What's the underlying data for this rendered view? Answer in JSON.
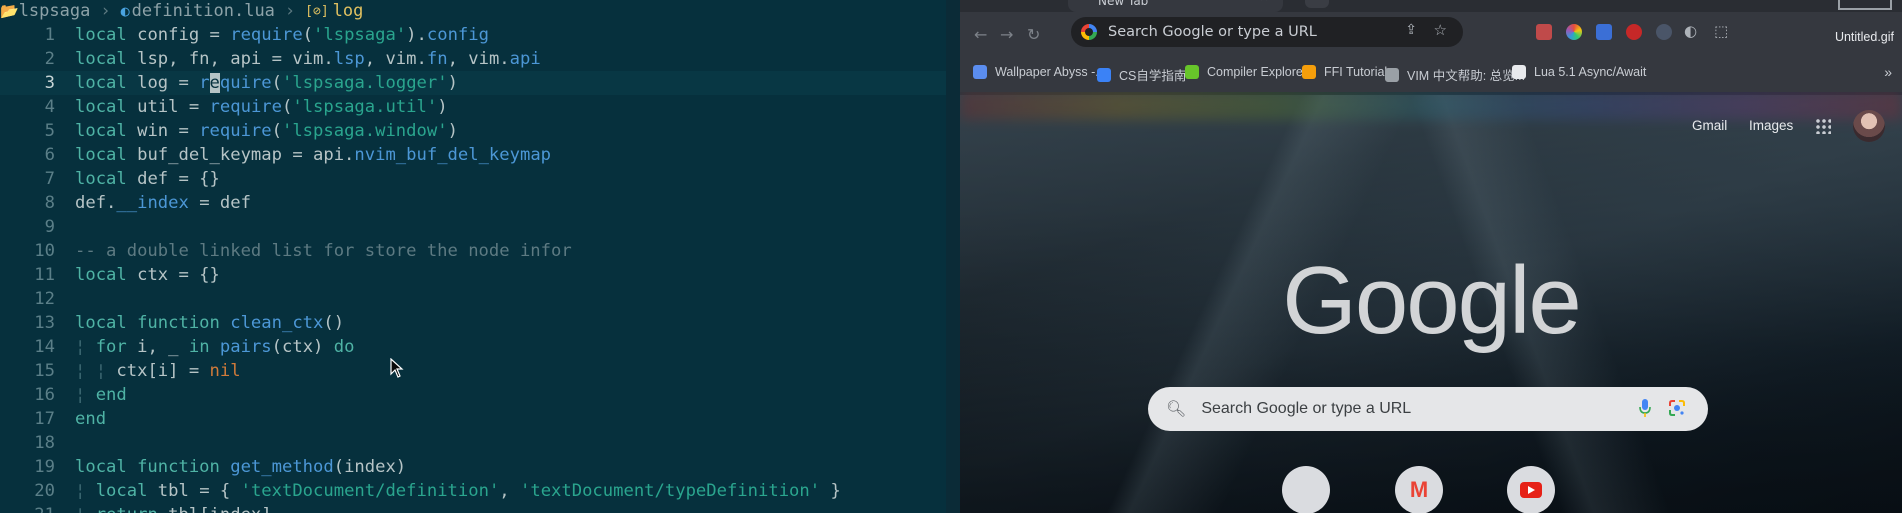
{
  "editor": {
    "winbar": {
      "folder": "lspsaga",
      "file": "definition.lua",
      "symbol": "log"
    },
    "current_line": 3,
    "lines": [
      {
        "n": "1",
        "tokens": [
          [
            "kw",
            "local"
          ],
          [
            "op",
            " config = "
          ],
          [
            "fn",
            "require"
          ],
          [
            "op",
            "("
          ],
          [
            "str",
            "'lspsaga'"
          ],
          [
            "op",
            ")."
          ],
          [
            "fn",
            "config"
          ]
        ]
      },
      {
        "n": "2",
        "tokens": [
          [
            "kw",
            "local"
          ],
          [
            "op",
            " lsp, fn, api = vim."
          ],
          [
            "fn",
            "lsp"
          ],
          [
            "op",
            ", vim."
          ],
          [
            "fn",
            "fn"
          ],
          [
            "op",
            ", vim."
          ],
          [
            "fn",
            "api"
          ]
        ]
      },
      {
        "n": "3",
        "tokens": [
          [
            "kw",
            "local"
          ],
          [
            "op",
            " log = "
          ],
          [
            "fn",
            "r"
          ],
          [
            "cursor",
            "e"
          ],
          [
            "fn",
            "quire"
          ],
          [
            "op",
            "("
          ],
          [
            "str",
            "'lspsaga.logger'"
          ],
          [
            "op",
            ")"
          ]
        ]
      },
      {
        "n": "4",
        "tokens": [
          [
            "kw",
            "local"
          ],
          [
            "op",
            " util = "
          ],
          [
            "fn",
            "require"
          ],
          [
            "op",
            "("
          ],
          [
            "str",
            "'lspsaga.util'"
          ],
          [
            "op",
            ")"
          ]
        ]
      },
      {
        "n": "5",
        "tokens": [
          [
            "kw",
            "local"
          ],
          [
            "op",
            " win = "
          ],
          [
            "fn",
            "require"
          ],
          [
            "op",
            "("
          ],
          [
            "str",
            "'lspsaga.window'"
          ],
          [
            "op",
            ")"
          ]
        ]
      },
      {
        "n": "6",
        "tokens": [
          [
            "kw",
            "local"
          ],
          [
            "op",
            " buf_del_keymap = api."
          ],
          [
            "fn",
            "nvim_buf_del_keymap"
          ]
        ]
      },
      {
        "n": "7",
        "tokens": [
          [
            "kw",
            "local"
          ],
          [
            "op",
            " def = {}"
          ]
        ]
      },
      {
        "n": "8",
        "tokens": [
          [
            "op",
            "def."
          ],
          [
            "fn",
            "__index"
          ],
          [
            "op",
            " = def"
          ]
        ]
      },
      {
        "n": "9",
        "tokens": []
      },
      {
        "n": "10",
        "tokens": [
          [
            "cm",
            "-- a double linked list for store the node infor"
          ]
        ]
      },
      {
        "n": "11",
        "tokens": [
          [
            "kw",
            "local"
          ],
          [
            "op",
            " ctx = {}"
          ]
        ]
      },
      {
        "n": "12",
        "tokens": []
      },
      {
        "n": "13",
        "tokens": [
          [
            "kw",
            "local function"
          ],
          [
            "op",
            " "
          ],
          [
            "fn",
            "clean_ctx"
          ],
          [
            "op",
            "()"
          ]
        ]
      },
      {
        "n": "14",
        "tokens": [
          [
            "guide",
            "¦ "
          ],
          [
            "kw",
            "for"
          ],
          [
            "op",
            " i, _ "
          ],
          [
            "kw",
            "in"
          ],
          [
            "op",
            " "
          ],
          [
            "fn",
            "pairs"
          ],
          [
            "op",
            "(ctx) "
          ],
          [
            "kw",
            "do"
          ]
        ]
      },
      {
        "n": "15",
        "tokens": [
          [
            "guide",
            "¦ ¦ "
          ],
          [
            "op",
            "ctx[i] = "
          ],
          [
            "nil",
            "nil"
          ]
        ]
      },
      {
        "n": "16",
        "tokens": [
          [
            "guide",
            "¦ "
          ],
          [
            "kw",
            "end"
          ]
        ]
      },
      {
        "n": "17",
        "tokens": [
          [
            "kw",
            "end"
          ]
        ]
      },
      {
        "n": "18",
        "tokens": []
      },
      {
        "n": "19",
        "tokens": [
          [
            "kw",
            "local function"
          ],
          [
            "op",
            " "
          ],
          [
            "fn",
            "get_method"
          ],
          [
            "op",
            "(index)"
          ]
        ]
      },
      {
        "n": "20",
        "tokens": [
          [
            "guide",
            "¦ "
          ],
          [
            "kw",
            "local"
          ],
          [
            "op",
            " tbl = { "
          ],
          [
            "str",
            "'textDocument/definition'"
          ],
          [
            "op",
            ", "
          ],
          [
            "str",
            "'textDocument/typeDefinition'"
          ],
          [
            "op",
            " }"
          ]
        ]
      },
      {
        "n": "21",
        "tokens": [
          [
            "guide",
            "¦ "
          ],
          [
            "kw",
            "return"
          ],
          [
            "op",
            " tbl[index]"
          ]
        ]
      }
    ]
  },
  "browser": {
    "tab_title": "New Tab",
    "omnibox_placeholder": "Search Google or type a URL",
    "overlay_filename": "Untitled.gif",
    "bookmarks": [
      {
        "label": "Wallpaper Abyss -...",
        "icon": "wallpaper-abyss-icon",
        "color": "#5b8def"
      },
      {
        "label": "CS自学指南",
        "icon": "cs-guide-icon",
        "color": "#3b82f6"
      },
      {
        "label": "Compiler Explorer",
        "icon": "compiler-explorer-icon",
        "color": "#67c52a"
      },
      {
        "label": "FFI Tutorial",
        "icon": "ffi-tutorial-icon",
        "color": "#f59e0b"
      },
      {
        "label": "VIM 中文帮助: 总览...",
        "icon": "globe-icon",
        "color": "#9aa0a6"
      },
      {
        "label": "Lua 5.1 Async/Await",
        "icon": "github-icon",
        "color": "#e8eaed"
      }
    ],
    "more_bookmarks": "»",
    "top_links": {
      "gmail": "Gmail",
      "images": "Images"
    },
    "logo": "Google",
    "search_placeholder": "Search Google or type a URL"
  }
}
